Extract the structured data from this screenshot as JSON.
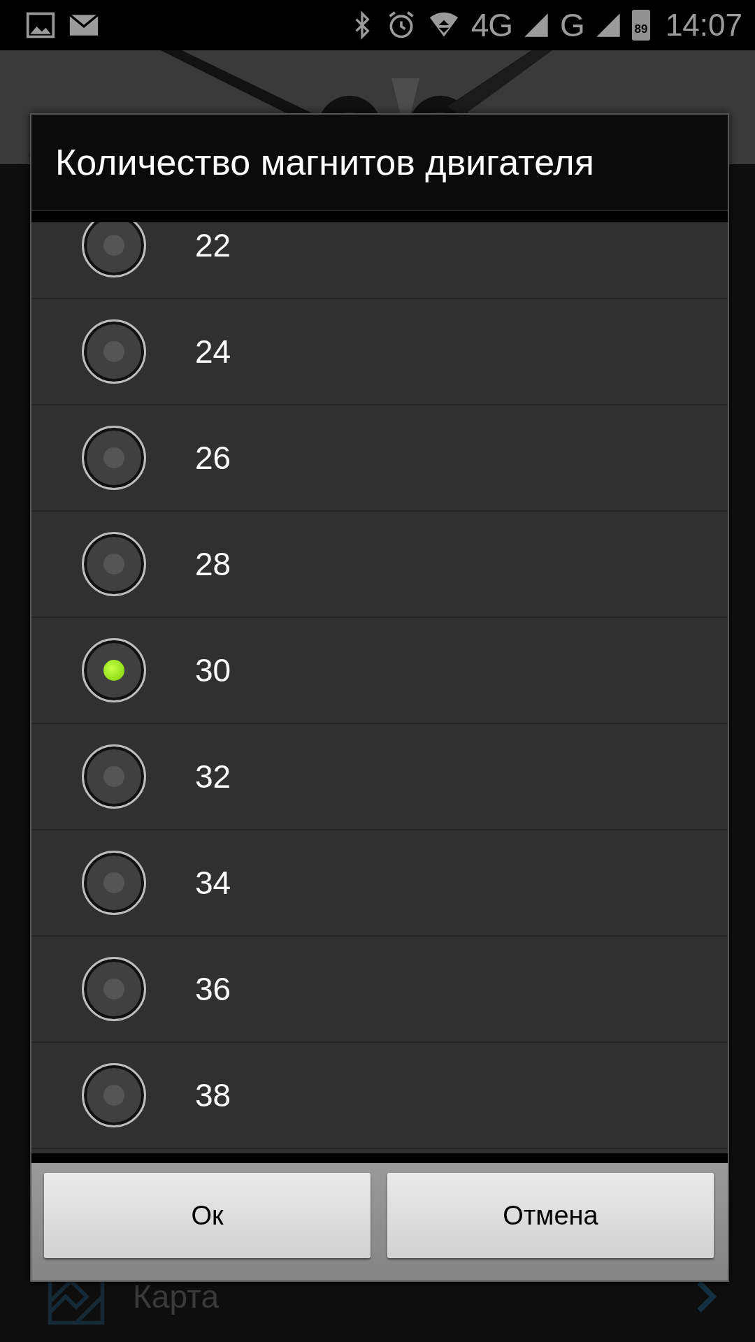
{
  "status_bar": {
    "network_primary": "4G",
    "network_secondary": "G",
    "battery": "89",
    "time": "14:07"
  },
  "background": {
    "menu_item": {
      "label": "Карта"
    }
  },
  "dialog": {
    "title": "Количество магнитов двигателя",
    "options": [
      {
        "label": "22",
        "selected": false
      },
      {
        "label": "24",
        "selected": false
      },
      {
        "label": "26",
        "selected": false
      },
      {
        "label": "28",
        "selected": false
      },
      {
        "label": "30",
        "selected": true
      },
      {
        "label": "32",
        "selected": false
      },
      {
        "label": "34",
        "selected": false
      },
      {
        "label": "36",
        "selected": false
      },
      {
        "label": "38",
        "selected": false
      }
    ],
    "buttons": [
      {
        "label": "Ок"
      },
      {
        "label": "Отмена"
      }
    ]
  }
}
